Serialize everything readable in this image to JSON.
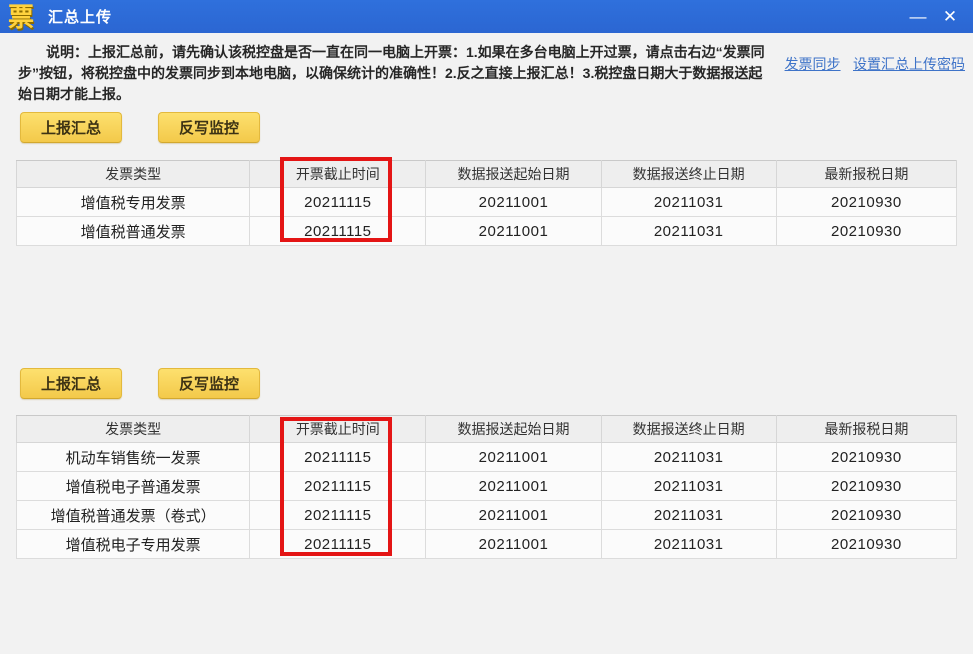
{
  "window": {
    "title": "汇总上传",
    "logo_char": "票",
    "minimize_glyph": "—",
    "close_glyph": "✕"
  },
  "description": {
    "lines": [
      "说明：上报汇总前，请先确认该税控盘是否一直在同一电脑上开票：1.如果在多台电脑上开过票，请点击右边“发票同",
      "步”按钮，将税控盘中的发票同步到本地电脑，以确保统计的准确性！2.反之直接上报汇总！3.税控盘日期大于数据报送起",
      "始日期才能上报。"
    ]
  },
  "links": [
    {
      "label": "发票同步"
    },
    {
      "label": "设置汇总上传密码"
    }
  ],
  "buttons": {
    "report_summary": "上报汇总",
    "writeback_monitor": "反写监控"
  },
  "table1": {
    "headers": [
      "发票类型",
      "开票截止时间",
      "数据报送起始日期",
      "数据报送终止日期",
      "最新报税日期"
    ],
    "rows": [
      [
        "增值税专用发票",
        "20211115",
        "20211001",
        "20211031",
        "20210930"
      ],
      [
        "增值税普通发票",
        "20211115",
        "20211001",
        "20211031",
        "20210930"
      ]
    ]
  },
  "table2": {
    "headers": [
      "发票类型",
      "开票截止时间",
      "数据报送起始日期",
      "数据报送终止日期",
      "最新报税日期"
    ],
    "rows": [
      [
        "机动车销售统一发票",
        "20211115",
        "20211001",
        "20211031",
        "20210930"
      ],
      [
        "增值税电子普通发票",
        "20211115",
        "20211001",
        "20211031",
        "20210930"
      ],
      [
        "增值税普通发票（卷式）",
        "20211115",
        "20211001",
        "20211031",
        "20210930"
      ],
      [
        "增值税电子专用发票",
        "20211115",
        "20211001",
        "20211031",
        "20210930"
      ]
    ]
  },
  "colors": {
    "titlebar_blue": "#2b66d2",
    "button_yellow": "#f5cf55",
    "highlight_red": "#e41515",
    "link_blue": "#3e73c8",
    "body_gray": "#f2f2f2"
  }
}
